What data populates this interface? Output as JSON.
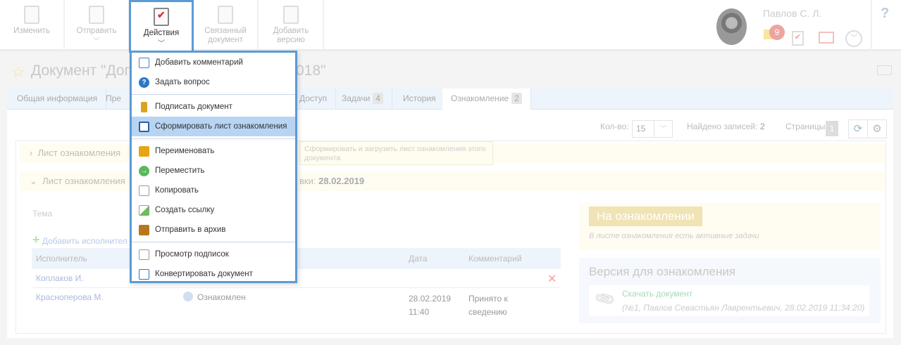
{
  "toolbar": {
    "buttons": [
      {
        "label": "Изменить"
      },
      {
        "label": "Отправить"
      },
      {
        "label": "Действия"
      },
      {
        "label": "Связанный документ"
      },
      {
        "label": "Добавить версию"
      }
    ]
  },
  "user": {
    "name": "Павлов С. Л.",
    "mail_count": "9",
    "help": "?"
  },
  "title": {
    "left": "Документ \"Дог",
    "right": "018\""
  },
  "tabs": [
    {
      "label": "Общая информация"
    },
    {
      "label": "Пре"
    },
    {
      "label": "Доступ"
    },
    {
      "label": "Задачи",
      "count": "4"
    },
    {
      "label": "История"
    },
    {
      "label": "Ознакомление",
      "count": "2"
    }
  ],
  "controls": {
    "count_label": "Кол-во:",
    "count_value": "15",
    "found_label": "Найдено записей:",
    "found_value": "2",
    "pages_label": "Страницы:",
    "page": "1"
  },
  "accordion": [
    {
      "label": "Лист ознакомления"
    },
    {
      "label": "Лист ознакомления",
      "date_label": "вки:",
      "date": "28.02.2019"
    }
  ],
  "tooltip": "Сформировать и загрузить лист ознакомления этого документа",
  "table": {
    "topic_label": "Тема",
    "add_label": "Добавить исполнител",
    "headers": [
      "Исполнитель",
      "Дата",
      "Комментарий"
    ],
    "rows": [
      {
        "executor": "Коплаков И.",
        "status": "",
        "date": "",
        "time": "",
        "comment": ""
      },
      {
        "executor": "Красноперова М.",
        "status": "Ознакомлен",
        "date": "28.02.2019",
        "time": "11:40",
        "comment": "Принято к сведению"
      }
    ]
  },
  "status": {
    "badge": "На ознакомлении",
    "note": "В листе ознакомления есть активные задачи"
  },
  "version": {
    "title": "Версия для ознакомления",
    "link": "Скачать документ",
    "meta": "(№1, Павлов Севастьян Лаврентьевич, 28.02.2019 11:34:20)"
  },
  "menu": {
    "items": [
      {
        "label": "Добавить комментарий",
        "color": "#4a7fc1"
      },
      {
        "label": "Задать вопрос",
        "color": "#2b78c5"
      },
      {
        "label": "Подписать документ",
        "color": "#d9a520"
      },
      {
        "label": "Сформировать лист ознакомления",
        "color": "#2b5ea8"
      },
      {
        "label": "Переименовать",
        "color": "#e8a417"
      },
      {
        "label": "Переместить",
        "color": "#5cb85c"
      },
      {
        "label": "Копировать",
        "color": "#999999"
      },
      {
        "label": "Создать ссылку",
        "color": "#6bbf59"
      },
      {
        "label": "Отправить в архив",
        "color": "#b5781a"
      },
      {
        "label": "Просмотр подписок",
        "color": "#999999"
      },
      {
        "label": "Конвертировать документ",
        "color": "#2b78c5"
      }
    ]
  }
}
